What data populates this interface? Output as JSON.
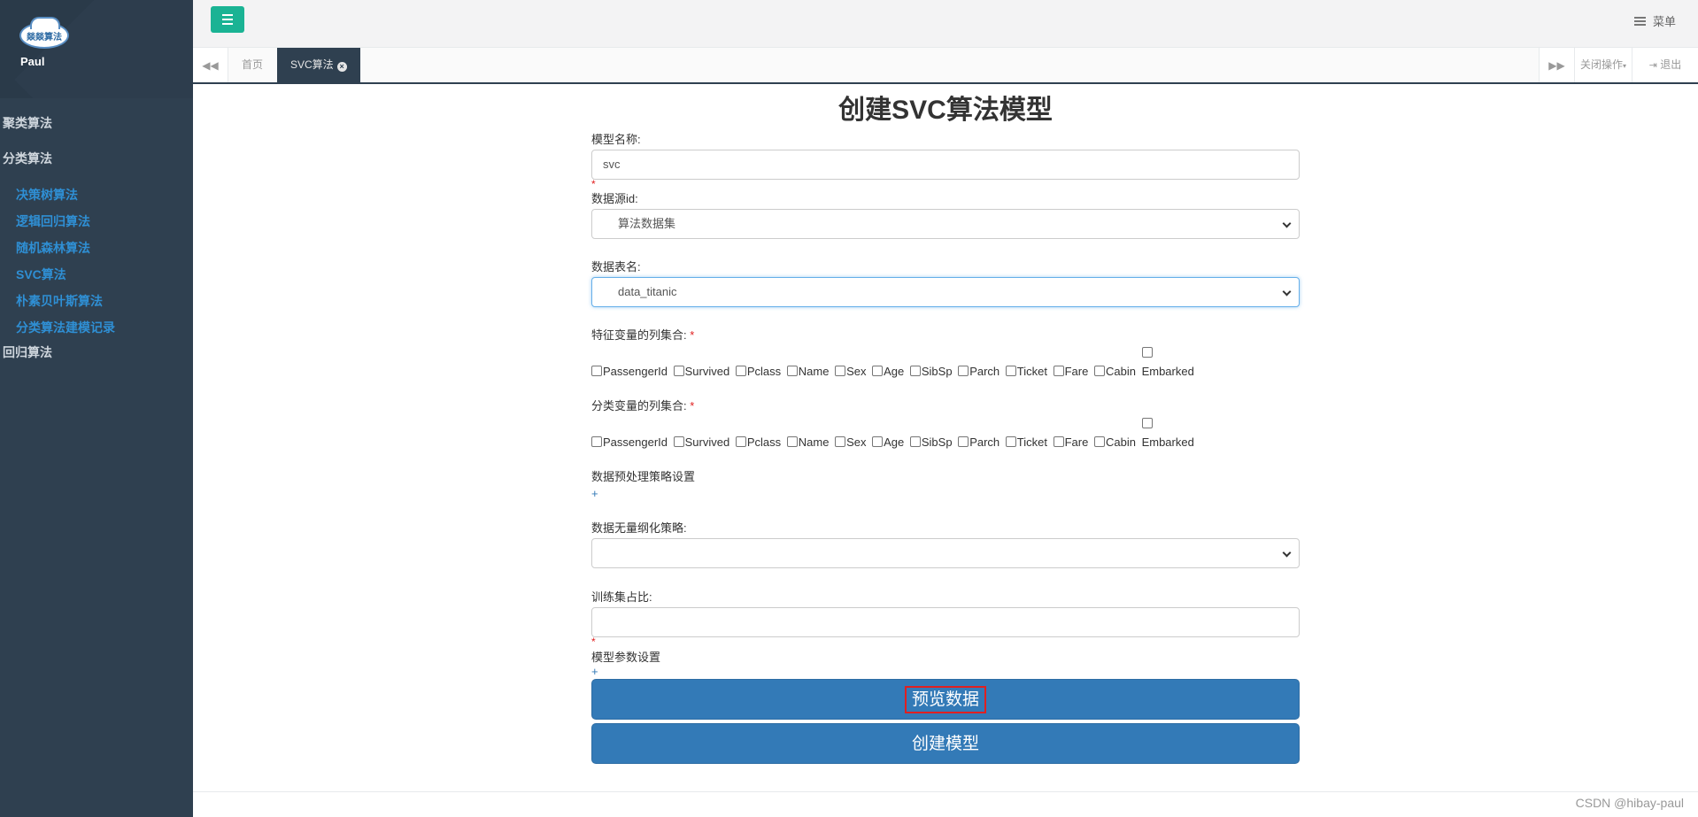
{
  "sidebar": {
    "logo_text": "燚燚算法",
    "user_name": "Paul",
    "groups": [
      {
        "label": "聚类算法"
      },
      {
        "label": "分类算法",
        "items": [
          "决策树算法",
          "逻辑回归算法",
          "随机森林算法",
          "SVC算法",
          "朴素贝叶斯算法",
          "分类算法建模记录"
        ]
      },
      {
        "label": "回归算法"
      }
    ]
  },
  "header": {
    "menu_label": "菜单"
  },
  "tabs": {
    "home": "首页",
    "active": "SVC算法",
    "close_ops": "关闭操作",
    "logout": "退出"
  },
  "page": {
    "title": "创建SVC算法模型"
  },
  "form": {
    "model_name_label": "模型名称:",
    "model_name_value": "svc",
    "datasource_label": "数据源id:",
    "datasource_value": "算法数据集",
    "table_label": "数据表名:",
    "table_value": "data_titanic",
    "feature_label": "特征变量的列集合:",
    "class_label": "分类变量的列集合:",
    "columns": [
      "PassengerId",
      "Survived",
      "Pclass",
      "Name",
      "Sex",
      "Age",
      "SibSp",
      "Parch",
      "Ticket",
      "Fare",
      "Cabin",
      "Embarked"
    ],
    "preprocess_label": "数据预处理策略设置",
    "scaling_label": "数据无量纲化策略:",
    "scaling_value": "",
    "train_ratio_label": "训练集占比:",
    "train_ratio_value": "",
    "params_label": "模型参数设置",
    "plus": "+",
    "star": "*",
    "preview_button": "预览数据",
    "create_button": "创建模型"
  },
  "watermark": "CSDN @hibay-paul"
}
